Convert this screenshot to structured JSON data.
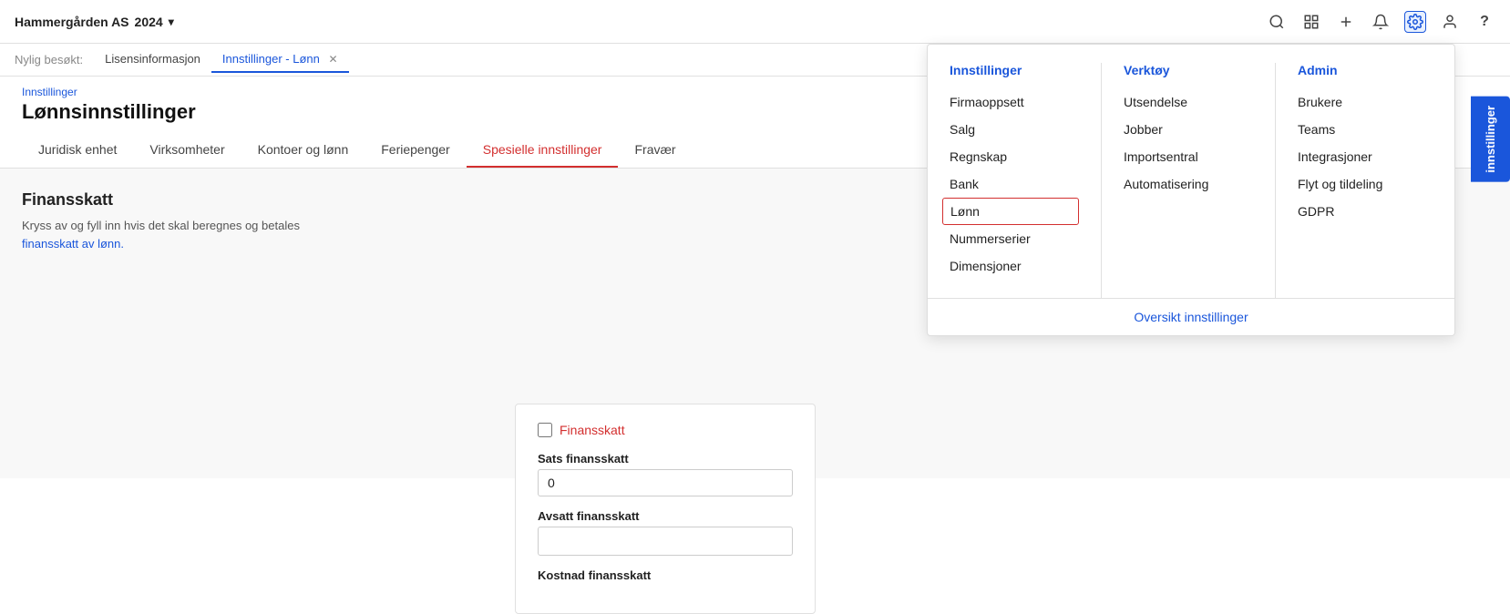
{
  "topbar": {
    "company": "Hammergården AS",
    "year": "2024",
    "icons": [
      "search",
      "grid",
      "plus",
      "bell",
      "gear",
      "user",
      "help"
    ]
  },
  "recentbar": {
    "label": "Nylig besøkt:",
    "tabs": [
      {
        "id": "lisensinformasjon",
        "label": "Lisensinformasjon",
        "active": false,
        "closable": false
      },
      {
        "id": "innstillinger-lonn",
        "label": "Innstillinger - Lønn",
        "active": true,
        "closable": true
      }
    ]
  },
  "breadcrumb": "Innstillinger",
  "page_title": "Lønnsinnstillinger",
  "tabs": [
    {
      "label": "Juridisk enhet",
      "active": false
    },
    {
      "label": "Virksomheter",
      "active": false
    },
    {
      "label": "Kontoer og lønn",
      "active": false
    },
    {
      "label": "Feriepenger",
      "active": false
    },
    {
      "label": "Spesielle innstillinger",
      "active": true
    },
    {
      "label": "Fravær",
      "active": false
    }
  ],
  "section": {
    "title": "Finansskatt",
    "description": "Kryss av og fyll inn hvis det skal beregnes og betales",
    "description2": "finansskatt av lønn."
  },
  "form": {
    "checkbox_label": "Finansskatt",
    "field1_label": "Sats finansskatt",
    "field1_value": "0",
    "field2_label": "Avsatt finansskatt",
    "field2_value": "",
    "field3_label": "Kostnad finansskatt",
    "field3_value": ""
  },
  "settings_btn": "innstillinger",
  "dropdown": {
    "col1": {
      "title": "Innstillinger",
      "items": [
        "Firmaoppsett",
        "Salg",
        "Regnskap",
        "Bank",
        "Lønn",
        "Nummerserier",
        "Dimensjoner"
      ]
    },
    "col2": {
      "title": "Verktøy",
      "items": [
        "Utsendelse",
        "Jobber",
        "Importsentral",
        "Automatisering"
      ]
    },
    "col3": {
      "title": "Admin",
      "items": [
        "Brukere",
        "Teams",
        "Integrasjoner",
        "Flyt og tildeling",
        "GDPR"
      ]
    },
    "footer": "Oversikt innstillinger"
  }
}
